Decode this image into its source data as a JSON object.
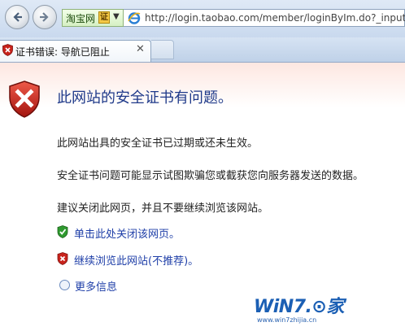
{
  "address_bar": {
    "site_identity": "淘宝网",
    "cert_badge": "证",
    "url": "http://login.taobao.com/member/loginByIm.do?_input_"
  },
  "tab": {
    "title": "证书错误: 导航已阻止",
    "close_glyph": "✕"
  },
  "page": {
    "heading": "此网站的安全证书有问题。",
    "paragraphs": [
      "此网站出具的安全证书已过期或还未生效。",
      "安全证书问题可能显示试图欺骗您或截获您向服务器发送的数据。",
      "建议关闭此网页，并且不要继续浏览该网站。"
    ],
    "option_close": "单击此处关闭该网页。",
    "option_continue": "继续浏览此网站(不推荐)。",
    "option_more": "更多信息"
  },
  "watermark": {
    "logo_text": "WiN7.⊙家",
    "url": "www.win7zhijia.cn"
  },
  "colors": {
    "heading": "#1f3a8a",
    "link": "#1f3fa8",
    "error_shield": "#c8231c",
    "ok_shield": "#2f9a2f",
    "banner_tint": "#fde7e1"
  },
  "icons": {
    "back": "back-arrow-icon",
    "forward": "forward-arrow-icon",
    "ie": "ie-logo-icon",
    "tab_cert": "certificate-error-icon",
    "heading": "error-shield-icon",
    "option_close": "green-shield-icon",
    "option_continue": "red-shield-icon",
    "option_more": "expand-circle-icon"
  }
}
